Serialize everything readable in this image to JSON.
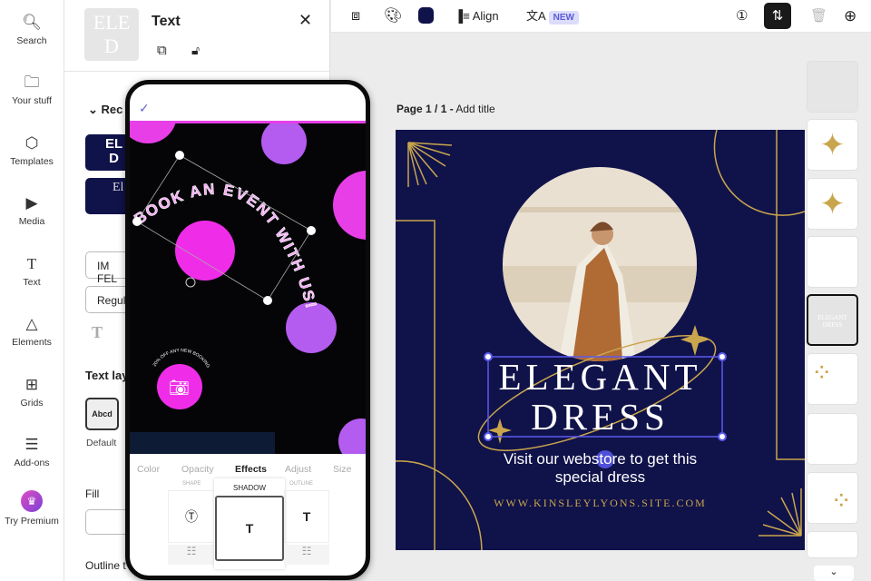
{
  "nav": [
    {
      "label": "Search",
      "icon": "search-icon"
    },
    {
      "label": "Your stuff",
      "icon": "folder-icon"
    },
    {
      "label": "Templates",
      "icon": "templates-icon"
    },
    {
      "label": "Media",
      "icon": "media-icon"
    },
    {
      "label": "Text",
      "icon": "text-icon"
    },
    {
      "label": "Elements",
      "icon": "elements-icon"
    },
    {
      "label": "Grids",
      "icon": "grids-icon"
    },
    {
      "label": "Add-ons",
      "icon": "addons-icon"
    },
    {
      "label": "Try Premium",
      "icon": "crown-icon"
    }
  ],
  "panel": {
    "title": "Text",
    "recent_label": "Rec",
    "font_value": "IM FEL",
    "style_value": "Regula",
    "text_layout_label": "Text lay",
    "layout_option": "Abcd",
    "layout_option_label": "Default",
    "fill_label": "Fill",
    "outline_label": "Outline t"
  },
  "toolbar": {
    "align": "Align",
    "new_badge": "NEW",
    "color_swatch": "#10124a"
  },
  "page": {
    "label": "Page 1 / 1 -",
    "add_title": "Add title"
  },
  "design": {
    "headline1": "ELEGANT",
    "headline2": "DRESS",
    "subtitle1": "Visit our webstore to get this",
    "subtitle2": "special dress",
    "url": "WWW.KINSLEYLYONS.SITE.COM",
    "bg": "#10124a",
    "accent": "#c9a64d"
  },
  "phone": {
    "curved_text": "BOOK AN EVENT WITH US!",
    "badge_text": "20% OFF ANY NEW BOOKING",
    "tabs": [
      "Color",
      "Opacity",
      "Effects",
      "Adjust",
      "Size"
    ],
    "active_tab": "Effects",
    "effects": [
      "SHAPE",
      "SHADOW",
      "OUTLINE"
    ],
    "selected_effect": "SHADOW"
  }
}
